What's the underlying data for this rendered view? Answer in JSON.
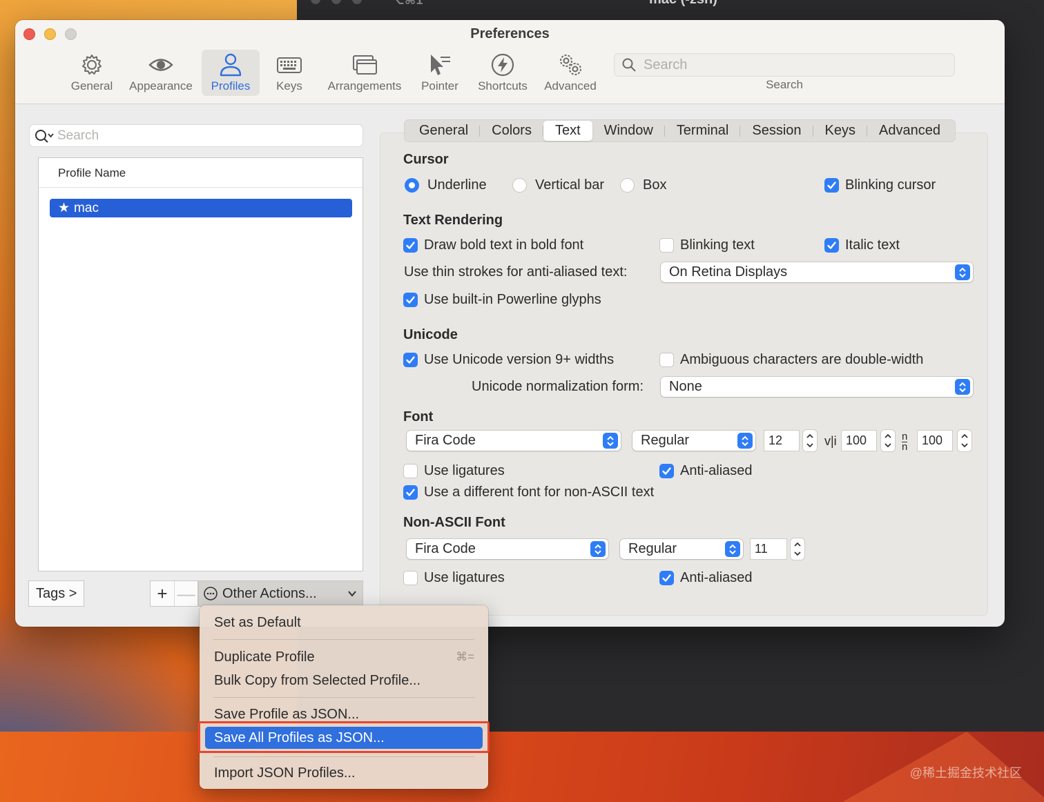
{
  "window": {
    "title": "Preferences",
    "terminal_title_partial": "mac (-zsh)",
    "terminal_cmd_partial": "⌥⌘1"
  },
  "toolbar": {
    "items": [
      {
        "label": "General",
        "icon": "gear-icon",
        "active": false
      },
      {
        "label": "Appearance",
        "icon": "eye-icon",
        "active": false
      },
      {
        "label": "Profiles",
        "icon": "person-icon",
        "active": true
      },
      {
        "label": "Keys",
        "icon": "keyboard-icon",
        "active": false
      },
      {
        "label": "Arrangements",
        "icon": "windows-icon",
        "active": false
      },
      {
        "label": "Pointer",
        "icon": "pointer-icon",
        "active": false
      },
      {
        "label": "Shortcuts",
        "icon": "lightning-icon",
        "active": false
      },
      {
        "label": "Advanced",
        "icon": "gears-icon",
        "active": false
      }
    ],
    "search_placeholder": "Search",
    "search_label": "Search"
  },
  "profiles": {
    "search_placeholder": "Search",
    "header": "Profile Name",
    "items": [
      {
        "name": "mac",
        "default": true,
        "selected": true
      }
    ],
    "tags_label": "Tags >",
    "add_label": "+",
    "remove_label": "—",
    "other_actions_label": "Other Actions..."
  },
  "tabs": [
    {
      "label": "General",
      "active": false
    },
    {
      "label": "Colors",
      "active": false
    },
    {
      "label": "Text",
      "active": true
    },
    {
      "label": "Window",
      "active": false
    },
    {
      "label": "Terminal",
      "active": false
    },
    {
      "label": "Session",
      "active": false
    },
    {
      "label": "Keys",
      "active": false
    },
    {
      "label": "Advanced",
      "active": false
    }
  ],
  "cursor": {
    "title": "Cursor",
    "options": [
      {
        "label": "Underline",
        "selected": true
      },
      {
        "label": "Vertical bar",
        "selected": false
      },
      {
        "label": "Box",
        "selected": false
      }
    ],
    "blinking_label": "Blinking cursor",
    "blinking": true
  },
  "text_rendering": {
    "title": "Text Rendering",
    "bold_label": "Draw bold text in bold font",
    "bold": true,
    "blinking_text_label": "Blinking text",
    "blinking_text": false,
    "italic_label": "Italic text",
    "italic": true,
    "thin_strokes_label": "Use thin strokes for anti-aliased text:",
    "thin_strokes_value": "On Retina Displays",
    "powerline_label": "Use built-in Powerline glyphs",
    "powerline": true
  },
  "unicode": {
    "title": "Unicode",
    "v9_label": "Use Unicode version 9+ widths",
    "v9": true,
    "ambiguous_label": "Ambiguous characters are double-width",
    "ambiguous": false,
    "normalization_label": "Unicode normalization form:",
    "normalization_value": "None"
  },
  "font": {
    "title": "Font",
    "family": "Fira Code",
    "style": "Regular",
    "size": "12",
    "h_spacing": "100",
    "v_spacing": "100",
    "h_glyph": "v|i",
    "v_glyph": "n/n",
    "ligatures_label": "Use ligatures",
    "ligatures": false,
    "antialiased_label": "Anti-aliased",
    "antialiased": true,
    "non_ascii_label": "Use a different font for non-ASCII text",
    "non_ascii": true
  },
  "non_ascii_font": {
    "title": "Non-ASCII Font",
    "family": "Fira Code",
    "style": "Regular",
    "size": "11",
    "ligatures_label": "Use ligatures",
    "ligatures": false,
    "antialiased_label": "Anti-aliased",
    "antialiased": true
  },
  "menu": {
    "items": [
      {
        "label": "Set as Default"
      },
      {
        "label": "Duplicate Profile",
        "shortcut": "⌘="
      },
      {
        "label": "Bulk Copy from Selected Profile..."
      },
      {
        "label": "Save Profile as JSON..."
      },
      {
        "label": "Save All Profiles as JSON...",
        "highlighted": true
      },
      {
        "label": "Import JSON Profiles..."
      }
    ]
  },
  "watermark": "@稀土掘金技术社区",
  "colors": {
    "accent": "#2f7df6",
    "selection": "#2760d6",
    "callout": "#e8452c"
  }
}
